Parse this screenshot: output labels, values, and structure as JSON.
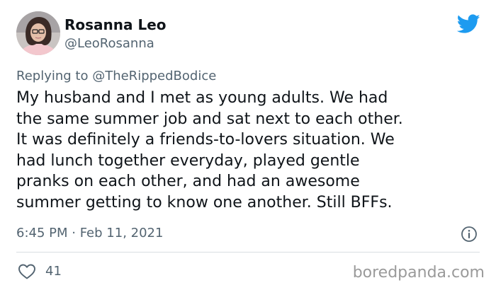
{
  "author": {
    "display_name": "Rosanna Leo",
    "handle": "@LeoRosanna"
  },
  "reply": {
    "prefix": "Replying to ",
    "mention": "@TheRippedBodice"
  },
  "tweet": {
    "lines": [
      "My husband and I met as young adults. We had",
      "the same summer job and sat next to each other.",
      "It was definitely a friends-to-lovers situation. We",
      "had lunch together everyday, played gentle",
      "pranks on each other, and had an awesome",
      "summer getting to know one another. Still BFFs."
    ],
    "timestamp": "6:45 PM · Feb 11, 2021"
  },
  "stats": {
    "likes": "41"
  },
  "watermark": "boredpanda.com",
  "icons": {
    "brand": "twitter-bird-icon",
    "info": "info-icon",
    "like": "heart-icon"
  },
  "colors": {
    "brand_blue": "#1d9bf0",
    "text": "#0f1419",
    "secondary": "#536471",
    "watermark": "#9a9a9a"
  }
}
